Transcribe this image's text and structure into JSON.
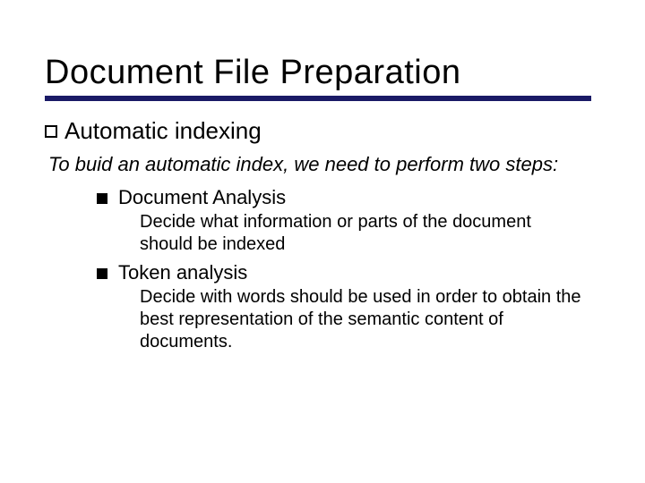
{
  "slide": {
    "title": "Document File Preparation",
    "section": "Automatic indexing",
    "intro": "To buid an automatic index, we need to perform two steps:",
    "items": [
      {
        "label": "Document Analysis",
        "desc": "Decide what information or parts of the document should be indexed"
      },
      {
        "label": "Token analysis",
        "desc": "Decide with words should be used in order to obtain the best representation of the semantic content of documents."
      }
    ]
  }
}
